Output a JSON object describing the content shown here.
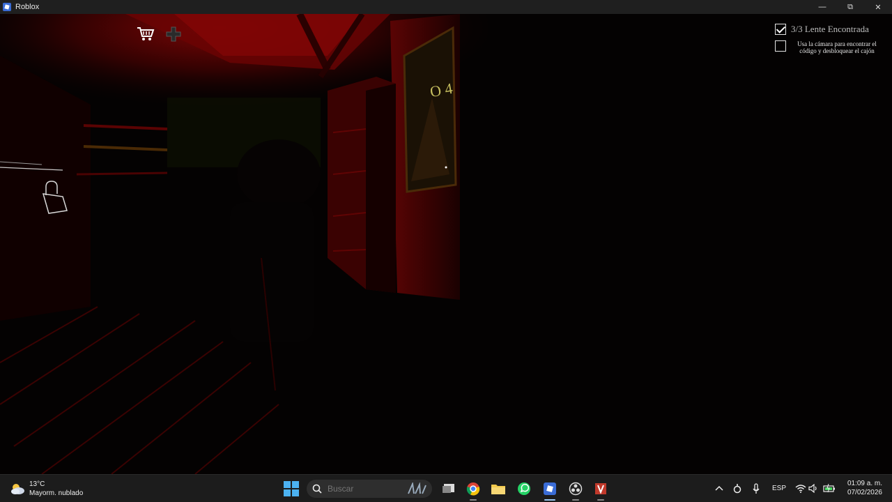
{
  "window": {
    "title": "Roblox",
    "minimize": "—",
    "maximize": "⧉",
    "close": "✕"
  },
  "scene": {
    "wall_code": "O 4"
  },
  "hud": {
    "shop_icon": "cart-icon",
    "more_icon": "plus-icon"
  },
  "objectives": [
    {
      "checked": true,
      "text": "3/3 Lente Encontrada"
    },
    {
      "checked": false,
      "text": "Usa la cámara para encontrar el código y desbloquear el cajón"
    }
  ],
  "taskbar": {
    "weather": {
      "temp": "13°C",
      "desc": "Mayorm. nublado"
    },
    "search_placeholder": "Buscar",
    "apps": [
      "task-view",
      "chrome",
      "file-explorer",
      "whatsapp",
      "roblox",
      "obs",
      "studio"
    ],
    "language": "ESP",
    "time": "01:09 a. m.",
    "date": "07/02/2026"
  },
  "colors": {
    "accent": "#4cb2f2",
    "taskbar": "#1c1c1c",
    "room_red": "#8b0000"
  }
}
